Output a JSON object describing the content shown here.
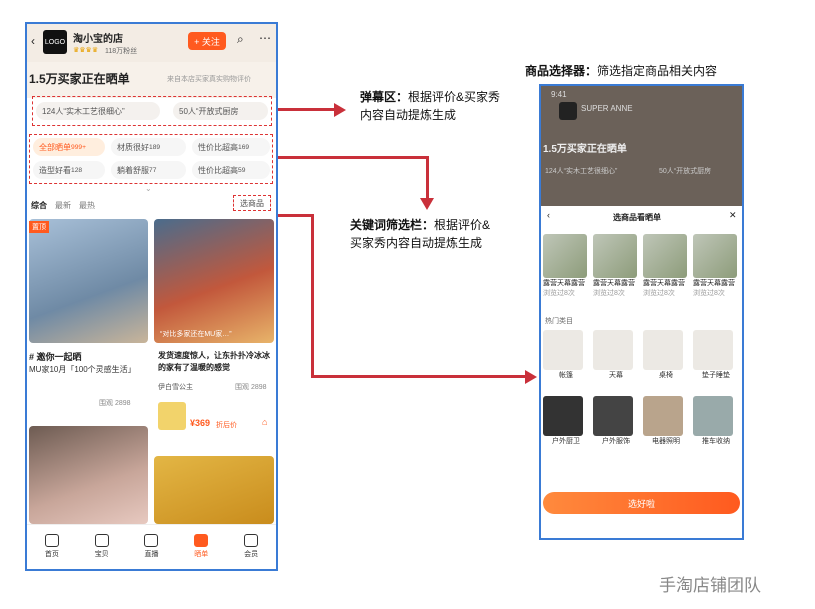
{
  "left_phone": {
    "shop_name": "淘小宝的店",
    "shop_stats": "118万粉丝",
    "logo_text": "LOGO",
    "follow_label": "+ 关注",
    "heading": "1.5万买家正在晒单",
    "heading_note": "来自本店买家真实购物评价",
    "barrage": [
      "124人“实木工艺很细心”",
      "50人“开放式厨房"
    ],
    "filters": [
      {
        "label": "全部晒单",
        "count": "999+"
      },
      {
        "label": "材质很好",
        "count": "189"
      },
      {
        "label": "性价比超高",
        "count": "169"
      },
      {
        "label": "造型好看",
        "count": "128"
      },
      {
        "label": "躺着舒服",
        "count": "77"
      },
      {
        "label": "性价比超高",
        "count": "59"
      }
    ],
    "sort_tabs": [
      "综合",
      "最新",
      "最热"
    ],
    "select_product": "选商品",
    "cards": [
      {
        "badge": "置顶",
        "title": "# 邀你一起晒",
        "sub": "MU家10月「100个灵感生活」",
        "user": "",
        "views": "围观 2898"
      },
      {
        "caption": "“对比多家还在MU家…”",
        "title": "发货速度惊人，让东扑扑冷冰冰的家有了温暖的感觉",
        "user": "伊白雪公主",
        "views": "围观 2898",
        "price": "¥369",
        "price_note": "折后价"
      }
    ],
    "nav": [
      "首页",
      "宝贝",
      "直播",
      "晒单",
      "会员"
    ]
  },
  "right_phone": {
    "time": "9:41",
    "shop_name": "SUPER ANNE",
    "heading": "1.5万买家正在晒单",
    "barrage": [
      "124人“实木工艺很细心”",
      "50人“开放式厨房"
    ],
    "modal_title": "选商品看晒单",
    "products": [
      {
        "name": "露营天幕露营",
        "note": "浏览过8次"
      },
      {
        "name": "露营天幕露营",
        "note": "浏览过8次"
      },
      {
        "name": "露营天幕露营",
        "note": "浏览过8次"
      },
      {
        "name": "露营天幕露营",
        "note": "浏览过8次"
      }
    ],
    "section_label": "热门类目",
    "categories": [
      "帐篷",
      "天幕",
      "桌椅",
      "垫子睡垫",
      "户外厨卫",
      "户外服饰",
      "电器照明",
      "推车收纳"
    ],
    "confirm_label": "选好啦"
  },
  "annotations": {
    "barrage_title": "弹幕区：",
    "barrage_text": "根据评价&买家秀内容自动提炼生成",
    "keyword_title": "关键词筛选栏：",
    "keyword_text": "根据评价&买家秀内容自动提炼生成",
    "selector_title": "商品选择器：",
    "selector_text": "筛选指定商品相关内容"
  },
  "watermark": "手淘店铺团队",
  "colors": {
    "accent": "#ff5a1f",
    "frame": "#3a7bd5",
    "arrow": "#c9303a"
  }
}
